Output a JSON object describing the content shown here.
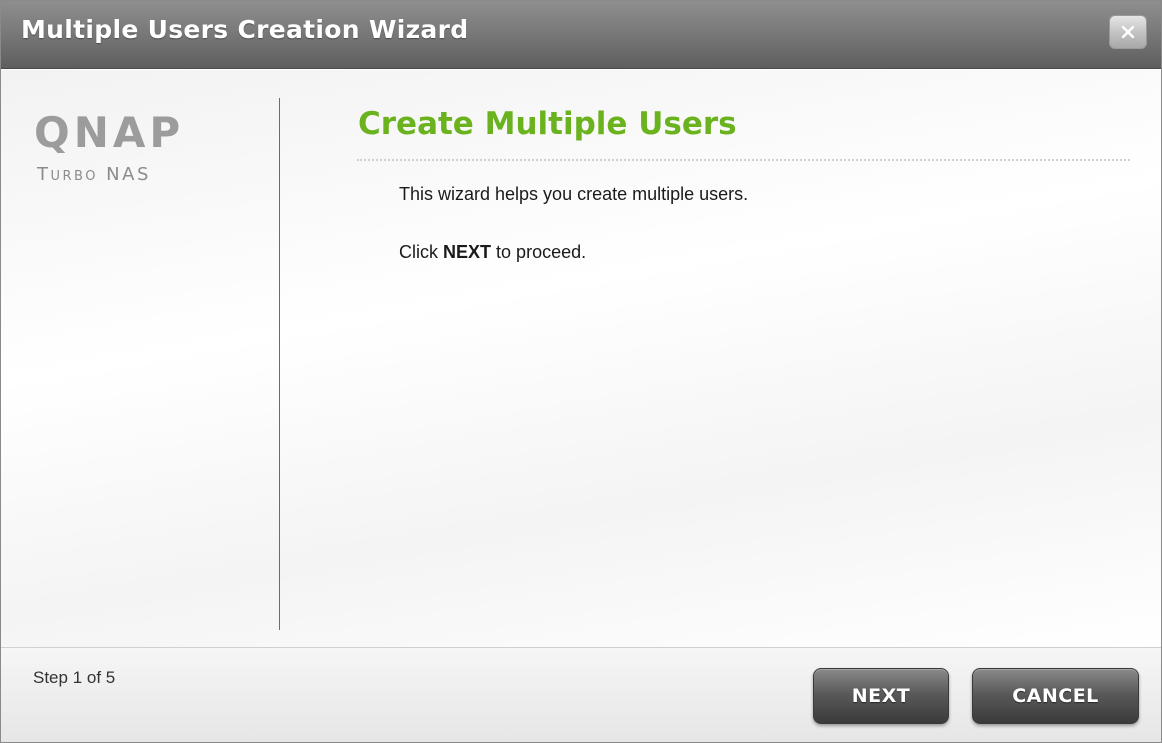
{
  "window": {
    "title": "Multiple Users Creation Wizard",
    "close_icon": "close-icon"
  },
  "logo": {
    "brand": "QNAP",
    "product": "Turbo NAS"
  },
  "main": {
    "page_title": "Create Multiple Users",
    "description": "This wizard helps you create multiple users.",
    "instruction_prefix": "Click",
    "instruction_keyword": "NEXT",
    "instruction_suffix": "to proceed."
  },
  "footer": {
    "step_text": "Step 1 of 5",
    "next_label": "NEXT",
    "cancel_label": "CANCEL"
  },
  "colors": {
    "title_accent": "#6ab21e",
    "titlebar": "#7a7a7a",
    "button": "#5a5a5a"
  }
}
